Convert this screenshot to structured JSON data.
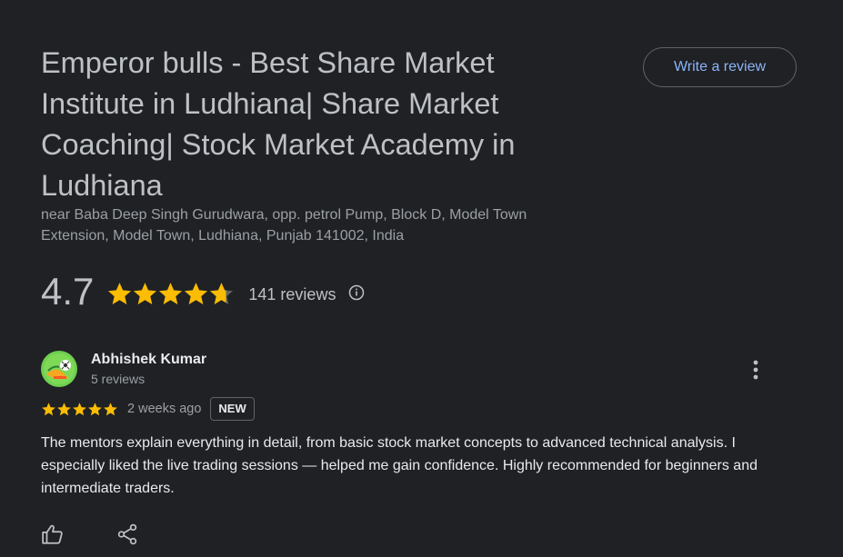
{
  "place": {
    "title": "Emperor bulls - Best Share Market Institute in Ludhiana| Share Market Coaching| Stock Market Academy in Ludhiana",
    "address": "near Baba Deep Singh Gurudwara, opp. petrol Pump, Block D, Model Town Extension, Model Town, Ludhiana, Punjab 141002, India",
    "write_review_label": "Write a review"
  },
  "rating": {
    "value": "4.7",
    "stars": 4.7,
    "count_label": "141 reviews",
    "info_icon": "info-icon"
  },
  "review": {
    "name": "Abhishek Kumar",
    "meta": "5 reviews",
    "stars": 5,
    "date": "2 weeks ago",
    "badge": "NEW",
    "text": "The mentors explain everything in detail, from basic stock market concepts to advanced technical analysis. I especially liked the live trading sessions — helped me gain confidence. Highly recommended for beginners and intermediate traders.",
    "actions": [
      "thumbs-up-icon",
      "share-icon"
    ],
    "menu_icon": "more-vert-icon"
  },
  "colors": {
    "background": "#202124",
    "star": "#fbbc04",
    "link": "#8ab4f8",
    "muted": "#9aa0a6"
  }
}
